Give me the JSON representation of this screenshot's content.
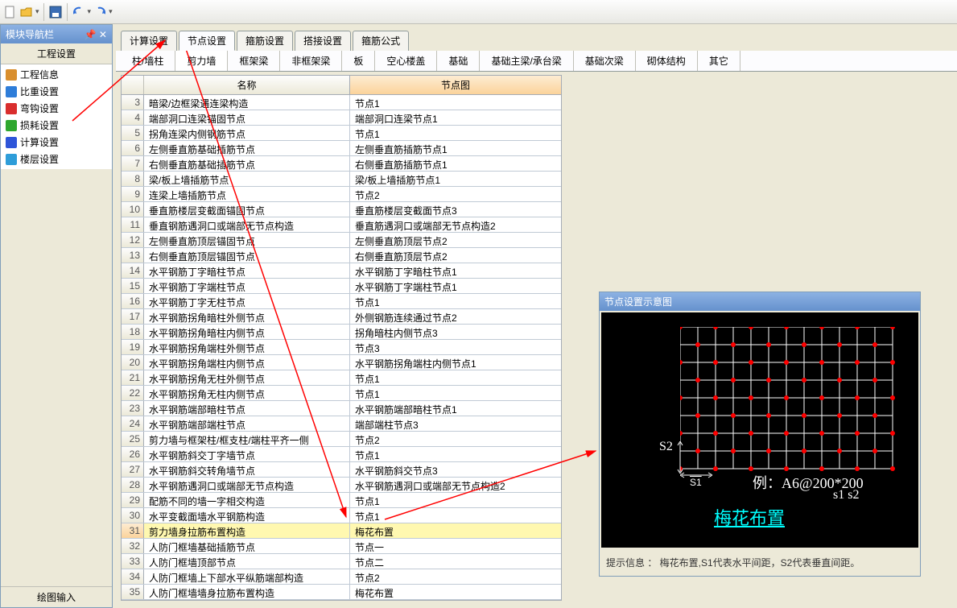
{
  "toolbar_icons": [
    "new",
    "open",
    "save",
    "undo",
    "redo"
  ],
  "left": {
    "header": "模块导航栏",
    "section": "工程设置",
    "items": [
      {
        "icon": "#d98f2e",
        "label": "工程信息"
      },
      {
        "icon": "#2e7dd9",
        "label": "比重设置"
      },
      {
        "icon": "#d92e2e",
        "label": "弯钩设置"
      },
      {
        "icon": "#2ea72e",
        "label": "损耗设置"
      },
      {
        "icon": "#2e55d9",
        "label": "计算设置"
      },
      {
        "icon": "#2e9dd9",
        "label": "楼层设置"
      }
    ],
    "footer": "绘图输入"
  },
  "tabs": [
    "计算设置",
    "节点设置",
    "箍筋设置",
    "搭接设置",
    "箍筋公式"
  ],
  "active_tab": 1,
  "subtabs": [
    "柱/墙柱",
    "剪力墙",
    "框架梁",
    "非框架梁",
    "板",
    "空心楼盖",
    "基础",
    "基础主梁/承台梁",
    "基础次梁",
    "砌体结构",
    "其它"
  ],
  "active_subtab": 1,
  "columns": {
    "name": "名称",
    "value": "节点图"
  },
  "rows": [
    {
      "n": 3,
      "name": "暗梁/边框梁遇连梁构造",
      "value": "节点1"
    },
    {
      "n": 4,
      "name": "端部洞口连梁锚固节点",
      "value": "端部洞口连梁节点1"
    },
    {
      "n": 5,
      "name": "拐角连梁内侧钢筋节点",
      "value": "节点1"
    },
    {
      "n": 6,
      "name": "左侧垂直筋基础插筋节点",
      "value": "左侧垂直筋插筋节点1"
    },
    {
      "n": 7,
      "name": "右侧垂直筋基础插筋节点",
      "value": "右侧垂直筋插筋节点1"
    },
    {
      "n": 8,
      "name": "梁/板上墙插筋节点",
      "value": "梁/板上墙插筋节点1"
    },
    {
      "n": 9,
      "name": "连梁上墙插筋节点",
      "value": "节点2"
    },
    {
      "n": 10,
      "name": "垂直筋楼层变截面锚固节点",
      "value": "垂直筋楼层变截面节点3"
    },
    {
      "n": 11,
      "name": "垂直钢筋遇洞口或端部无节点构造",
      "value": "垂直筋遇洞口或端部无节点构造2"
    },
    {
      "n": 12,
      "name": "左侧垂直筋顶层锚固节点",
      "value": "左侧垂直筋顶层节点2"
    },
    {
      "n": 13,
      "name": "右侧垂直筋顶层锚固节点",
      "value": "右侧垂直筋顶层节点2"
    },
    {
      "n": 14,
      "name": "水平钢筋丁字暗柱节点",
      "value": "水平钢筋丁字暗柱节点1"
    },
    {
      "n": 15,
      "name": "水平钢筋丁字端柱节点",
      "value": "水平钢筋丁字端柱节点1"
    },
    {
      "n": 16,
      "name": "水平钢筋丁字无柱节点",
      "value": "节点1"
    },
    {
      "n": 17,
      "name": "水平钢筋拐角暗柱外侧节点",
      "value": "外侧钢筋连续通过节点2"
    },
    {
      "n": 18,
      "name": "水平钢筋拐角暗柱内侧节点",
      "value": "拐角暗柱内侧节点3"
    },
    {
      "n": 19,
      "name": "水平钢筋拐角端柱外侧节点",
      "value": "节点3"
    },
    {
      "n": 20,
      "name": "水平钢筋拐角端柱内侧节点",
      "value": "水平钢筋拐角端柱内侧节点1"
    },
    {
      "n": 21,
      "name": "水平钢筋拐角无柱外侧节点",
      "value": "节点1"
    },
    {
      "n": 22,
      "name": "水平钢筋拐角无柱内侧节点",
      "value": "节点1"
    },
    {
      "n": 23,
      "name": "水平钢筋端部暗柱节点",
      "value": "水平钢筋端部暗柱节点1"
    },
    {
      "n": 24,
      "name": "水平钢筋端部端柱节点",
      "value": "端部端柱节点3"
    },
    {
      "n": 25,
      "name": "剪力墙与框架柱/框支柱/端柱平齐一侧",
      "value": "节点2"
    },
    {
      "n": 26,
      "name": "水平钢筋斜交丁字墙节点",
      "value": "节点1"
    },
    {
      "n": 27,
      "name": "水平钢筋斜交转角墙节点",
      "value": "水平钢筋斜交节点3"
    },
    {
      "n": 28,
      "name": "水平钢筋遇洞口或端部无节点构造",
      "value": "水平钢筋遇洞口或端部无节点构造2"
    },
    {
      "n": 29,
      "name": "配筋不同的墙一字相交构造",
      "value": "节点1"
    },
    {
      "n": 30,
      "name": "水平变截面墙水平钢筋构造",
      "value": "节点1"
    },
    {
      "n": 31,
      "name": "剪力墙身拉筋布置构造",
      "value": "梅花布置"
    },
    {
      "n": 32,
      "name": "人防门框墙基础插筋节点",
      "value": "节点一"
    },
    {
      "n": 33,
      "name": "人防门框墙顶部节点",
      "value": "节点二"
    },
    {
      "n": 34,
      "name": "人防门框墙上下部水平纵筋端部构造",
      "value": "节点2"
    },
    {
      "n": 35,
      "name": "人防门框墙墙身拉筋布置构造",
      "value": "梅花布置"
    }
  ],
  "selected_row": 31,
  "preview": {
    "title": "节点设置示意图",
    "s1": "S1",
    "s2": "S2",
    "example": "例：A6@200*200",
    "sub": "s1    s2",
    "link": "梅花布置",
    "hint": "提示信息 ： 梅花布置,S1代表水平间距，S2代表垂直间距。"
  }
}
